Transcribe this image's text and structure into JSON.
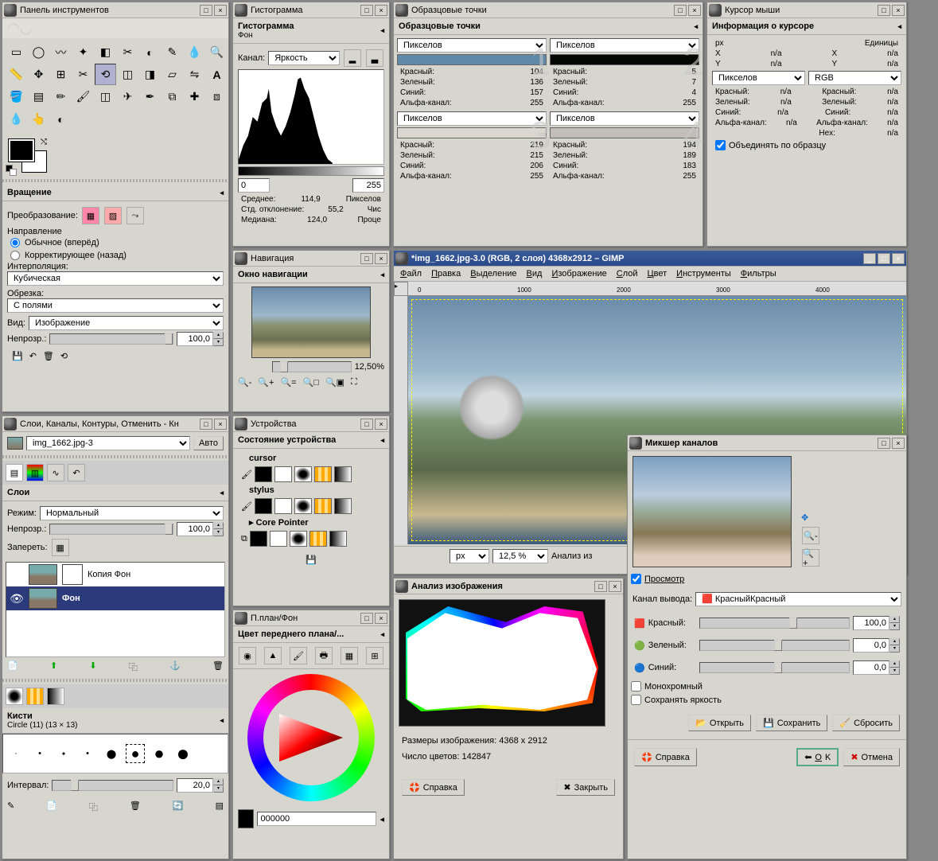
{
  "toolbox": {
    "title": "Панель инструментов",
    "rotation_section": "Вращение",
    "transform_label": "Преобразование:",
    "direction_label": "Направление",
    "dir_normal": "Обычное (вперёд)",
    "dir_correct": "Корректирующее (назад)",
    "interpolation_label": "Интерполяция:",
    "interpolation_value": "Кубическая",
    "crop_label": "Обрезка:",
    "crop_value": "С полями",
    "view_label": "Вид:",
    "view_value": "Изображение",
    "opacity_label": "Непрозр.:",
    "opacity_value": "100,0"
  },
  "histogram": {
    "title": "Гистограмма",
    "header": "Гистограмма",
    "sub": "Фон",
    "channel_label": "Канал:",
    "channel_value": "Яркость",
    "min": "0",
    "max": "255",
    "stats": {
      "mean_label": "Среднее:",
      "mean": "114,9",
      "stdev_label": "Стд. отклонение:",
      "stdev": "55,2",
      "median_label": "Медиана:",
      "median": "124,0",
      "pixels_label": "Пикселов",
      "count_label": "Чис",
      "percent_label": "Проце"
    }
  },
  "samples": {
    "title": "Образцовые точки",
    "header": "Образцовые точки",
    "unit": "Пикселов",
    "labels": {
      "r": "Красный:",
      "g": "Зеленый:",
      "b": "Синий:",
      "a": "Альфа-канал:"
    },
    "p1": {
      "r": "104",
      "g": "136",
      "b": "157",
      "a": "255",
      "color": "#5f89a7"
    },
    "p2": {
      "r": "5",
      "g": "7",
      "b": "4",
      "a": "255",
      "color": "#050704"
    },
    "p3": {
      "r": "219",
      "g": "215",
      "b": "206",
      "a": "255",
      "color": "#dbd7ce"
    },
    "p4": {
      "r": "194",
      "g": "189",
      "b": "183",
      "a": "255",
      "color": "#c2bdb7"
    }
  },
  "cursor": {
    "title": "Курсор мыши",
    "header": "Информация о курсоре",
    "px": "px",
    "units": "Единицы",
    "x": "X",
    "y": "Y",
    "na": "n/a",
    "unit_select": "Пикселов",
    "mode": "RGB",
    "labels": {
      "r": "Красный:",
      "g": "Зеленый:",
      "b": "Синий:",
      "a": "Альфа-канал:",
      "hex": "Hex:"
    },
    "merge": "Объединять по образцу"
  },
  "nav": {
    "title": "Навигация",
    "header": "Окно навигации",
    "zoom": "12,50%"
  },
  "devices": {
    "title": "Устройства",
    "header": "Состояние устройства",
    "cursor": "cursor",
    "stylus": "stylus",
    "core": "Core Pointer"
  },
  "fg": {
    "title": "П.план/Фон",
    "header": "Цвет переднего плана/...",
    "hex": "000000"
  },
  "layers": {
    "title": "Слои, Каналы, Контуры, Отменить - Кн",
    "file": "img_1662.jpg-3",
    "auto": "Авто",
    "layers_label": "Слои",
    "mode_label": "Режим:",
    "mode_value": "Нормальный",
    "opacity_label": "Непрозр.:",
    "opacity_value": "100,0",
    "lock_label": "Запереть:",
    "layer1": "Копия Фон",
    "layer2": "Фон",
    "brushes_label": "Кисти",
    "brush_name": "Circle (11) (13 × 13)",
    "interval_label": "Интервал:",
    "interval_value": "20,0"
  },
  "image": {
    "title": "*img_1662.jpg-3.0 (RGB, 2 слоя) 4368x2912 – GIMP",
    "menu": [
      "Файл",
      "Правка",
      "Выделение",
      "Вид",
      "Изображение",
      "Слой",
      "Цвет",
      "Инструменты",
      "Фильтры"
    ],
    "ruler_ticks": [
      "0",
      "1000",
      "2000",
      "3000",
      "4000"
    ],
    "unit": "px",
    "zoom": "12,5 %",
    "analiz": "Анализ из"
  },
  "analysis": {
    "title": "Анализ изображения",
    "size_label": "Размеры изображения: 4368 x 2912",
    "colors_label": "Число цветов: 142847",
    "help": "Справка",
    "close": "Закрыть"
  },
  "mixer": {
    "title": "Микшер каналов",
    "preview": "Просмотр",
    "output_label": "Канал вывода:",
    "output_value": "Красный",
    "r_label": "Красный:",
    "r_val": "100,0",
    "g_label": "Зеленый:",
    "g_val": "0,0",
    "b_label": "Синий:",
    "b_val": "0,0",
    "mono": "Монохромный",
    "preserve": "Сохранять яркость",
    "open": "Открыть",
    "save": "Сохранить",
    "reset": "Сбросить",
    "help": "Справка",
    "ok": "OK",
    "cancel": "Отмена"
  }
}
